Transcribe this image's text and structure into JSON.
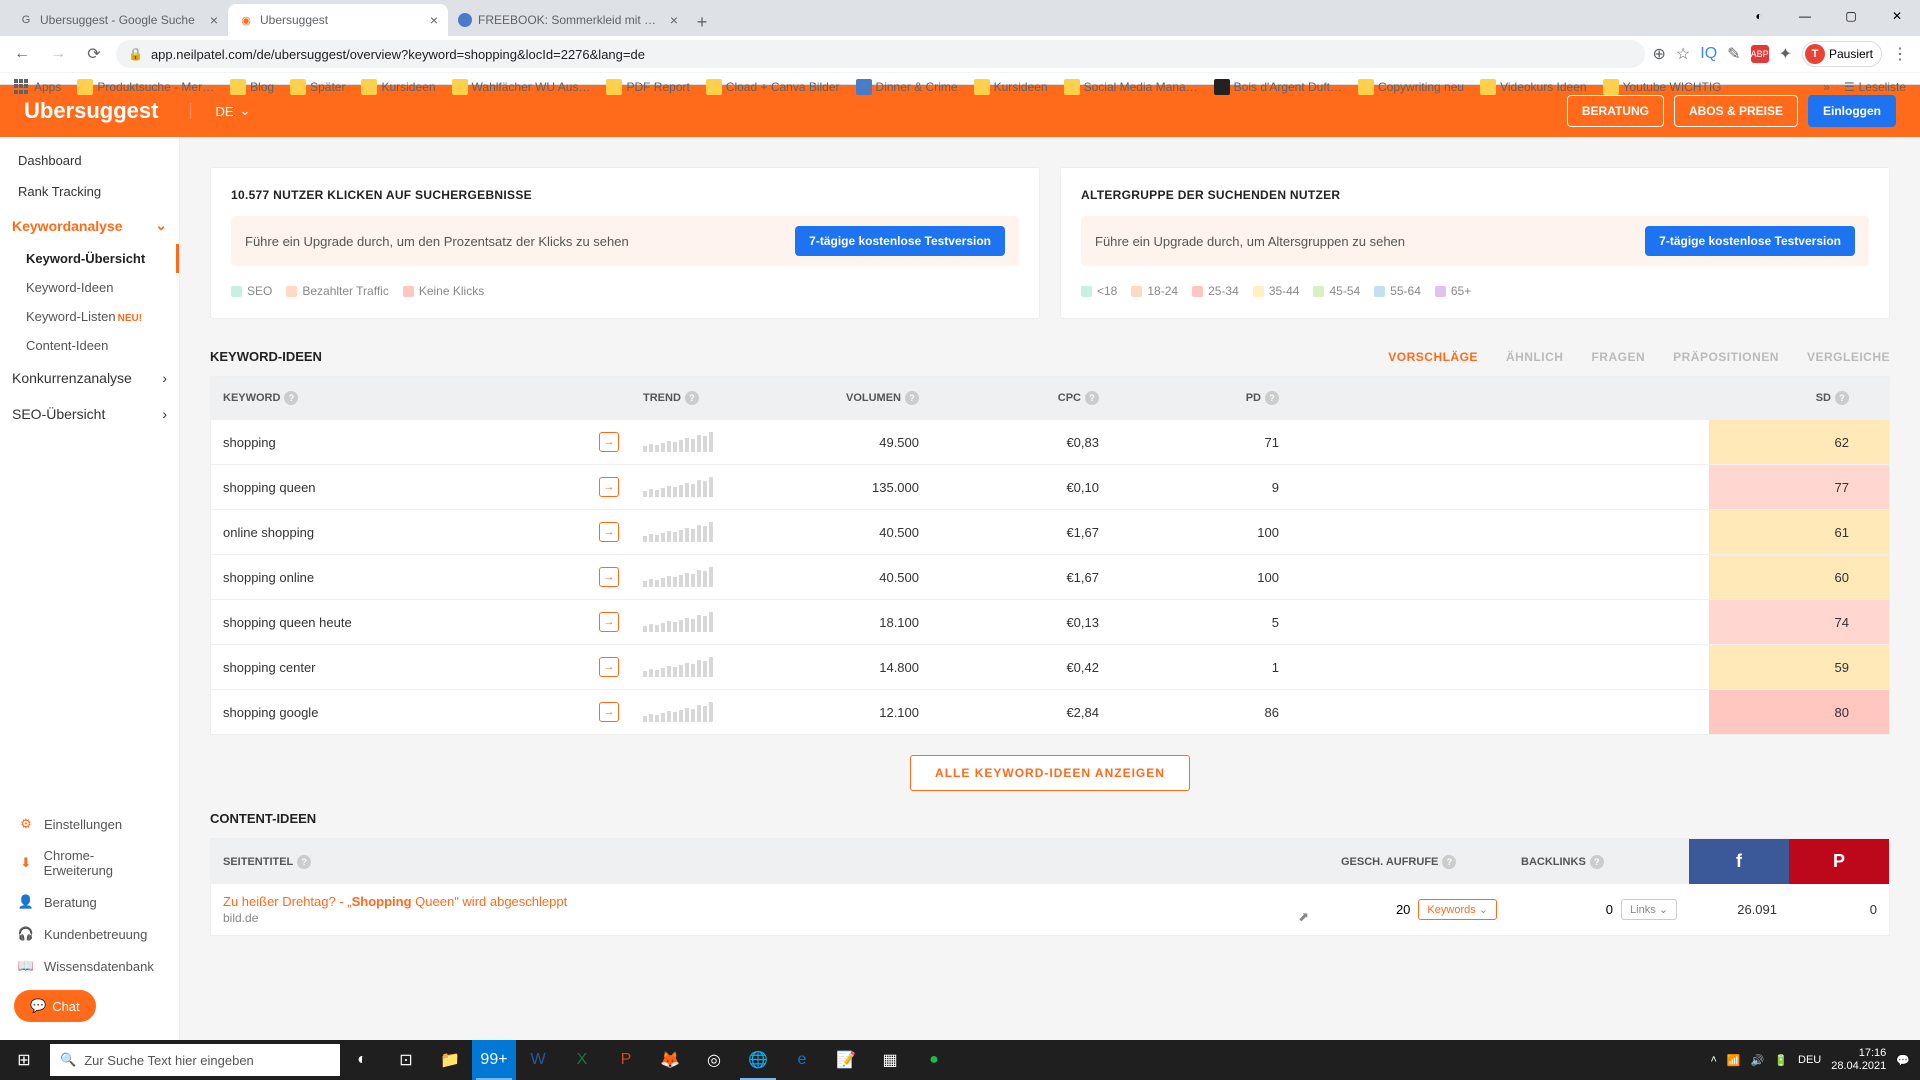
{
  "browser": {
    "tabs": [
      {
        "title": "Ubersuggest - Google Suche"
      },
      {
        "title": "Ubersuggest"
      },
      {
        "title": "FREEBOOK: Sommerkleid mit Sp…"
      }
    ],
    "url": "app.neilpatel.com/de/ubersuggest/overview?keyword=shopping&locId=2276&lang=de",
    "profile": {
      "letter": "T",
      "state": "Pausiert"
    },
    "bookmarks": [
      "Apps",
      "Produktsuche - Mer…",
      "Blog",
      "Später",
      "Kursideen",
      "Wahlfächer WU Aus…",
      "PDF Report",
      "Cload + Canva Bilder",
      "Dinner & Crime",
      "Kursideen",
      "Social Media Mana…",
      "Bois d'Argent Duft…",
      "Copywriting neu",
      "Videokurs Ideen",
      "Youtube WICHTIG"
    ],
    "reading_list": "Leseliste"
  },
  "header": {
    "logo": "Ubersuggest",
    "lang": "DE",
    "btn_consult": "BERATUNG",
    "btn_plans": "ABOS & PREISE",
    "btn_login": "Einloggen"
  },
  "sidebar": {
    "dashboard": "Dashboard",
    "rank": "Rank Tracking",
    "kw_analysis": "Keywordanalyse",
    "kw_overview": "Keyword-Übersicht",
    "kw_ideas": "Keyword-Ideen",
    "kw_lists": "Keyword-Listen",
    "kw_lists_badge": "NEU!",
    "content_ideas": "Content-Ideen",
    "comp": "Konkurrenzanalyse",
    "seo": "SEO-Übersicht",
    "settings": "Einstellungen",
    "chrome_ext": "Chrome-Erweiterung",
    "consult": "Beratung",
    "support": "Kundenbetreuung",
    "kb": "Wissensdatenbank",
    "chat": "Chat"
  },
  "panels": {
    "clicks_title": "10.577 NUTZER KLICKEN AUF SUCHERGEBNISSE",
    "clicks_upgrade": "Führe ein Upgrade durch, um den Prozentsatz der Klicks zu sehen",
    "age_title": "ALTERGRUPPE DER SUCHENDEN NUTZER",
    "age_upgrade": "Führe ein Upgrade durch, um Altersgruppen zu sehen",
    "trial_btn": "7-tägige kostenlose Testversion",
    "legend_clicks": [
      "SEO",
      "Bezahlter Traffic",
      "Keine Klicks"
    ],
    "legend_age": [
      "<18",
      "18-24",
      "25-34",
      "35-44",
      "45-54",
      "55-64",
      "65+"
    ]
  },
  "kw_ideas": {
    "title": "KEYWORD-IDEEN",
    "tabs": [
      "VORSCHLÄGE",
      "ÄHNLICH",
      "FRAGEN",
      "PRÄPOSITIONEN",
      "VERGLEICHE"
    ],
    "cols": {
      "kw": "KEYWORD",
      "trend": "TREND",
      "vol": "VOLUMEN",
      "cpc": "CPC",
      "pd": "PD",
      "sd": "SD"
    },
    "rows": [
      {
        "kw": "shopping",
        "vol": "49.500",
        "cpc": "€0,83",
        "pd": "71",
        "sd": "62",
        "sdc": "#ffe9b8"
      },
      {
        "kw": "shopping queen",
        "vol": "135.000",
        "cpc": "€0,10",
        "pd": "9",
        "sd": "77",
        "sdc": "#ffd6d0"
      },
      {
        "kw": "online shopping",
        "vol": "40.500",
        "cpc": "€1,67",
        "pd": "100",
        "sd": "61",
        "sdc": "#ffe9b8"
      },
      {
        "kw": "shopping online",
        "vol": "40.500",
        "cpc": "€1,67",
        "pd": "100",
        "sd": "60",
        "sdc": "#ffe9b8"
      },
      {
        "kw": "shopping queen heute",
        "vol": "18.100",
        "cpc": "€0,13",
        "pd": "5",
        "sd": "74",
        "sdc": "#ffd6d0"
      },
      {
        "kw": "shopping center",
        "vol": "14.800",
        "cpc": "€0,42",
        "pd": "1",
        "sd": "59",
        "sdc": "#ffe9b8"
      },
      {
        "kw": "shopping google",
        "vol": "12.100",
        "cpc": "€2,84",
        "pd": "86",
        "sd": "80",
        "sdc": "#ffc7bf"
      }
    ],
    "view_all": "ALLE KEYWORD-IDEEN ANZEIGEN"
  },
  "content_ideas": {
    "title": "CONTENT-IDEEN",
    "cols": {
      "title": "SEITENTITEL",
      "views": "GESCH. AUFRUFE",
      "back": "BACKLINKS"
    },
    "row": {
      "link_pre": "Zu heißer Drehtag? - „",
      "link_bold": "Shopping",
      "link_post": " Queen\" wird abgeschleppt",
      "domain": "bild.de",
      "views": "20",
      "kw_btn": "Keywords",
      "back": "0",
      "links_btn": "Links",
      "fb": "26.091",
      "pin": "0"
    }
  },
  "taskbar": {
    "search": "Zur Suche Text hier eingeben",
    "lang": "DEU",
    "time": "17:16",
    "date": "28.04.2021"
  }
}
